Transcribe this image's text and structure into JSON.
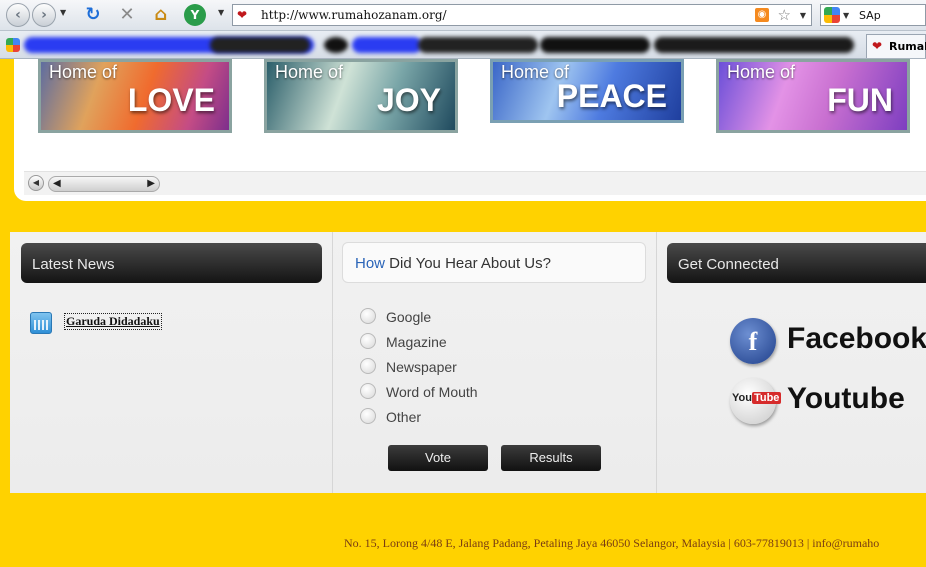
{
  "browser": {
    "url": "http://www.rumahozanam.org/",
    "search_text": "SAp",
    "tab_label": "Rumah"
  },
  "banners": [
    {
      "home": "Home of",
      "word": "LOVE"
    },
    {
      "home": "Home of",
      "word": "JOY"
    },
    {
      "home": "Home of",
      "word": "PEACE"
    },
    {
      "home": "Home of",
      "word": "FUN"
    }
  ],
  "latest_news": {
    "title": "Latest News",
    "items": [
      "Garuda Didadaku"
    ]
  },
  "poll": {
    "title_accent": "How",
    "title_rest": " Did You Hear About Us?",
    "options": [
      "Google",
      "Magazine",
      "Newspaper",
      "Word of Mouth",
      "Other"
    ],
    "vote_label": "Vote",
    "results_label": "Results"
  },
  "connected": {
    "title": "Get Connected",
    "facebook": "Facebook",
    "youtube": "Youtube",
    "youtube_mark_left": "You",
    "youtube_mark_right": "Tube",
    "facebook_glyph": "f"
  },
  "footer": {
    "text": "No. 15, Lorong 4/48 E, Jalang Padang, Petaling Jaya 46050 Selangor, Malaysia | 603-77819013 | info@rumaho"
  },
  "colors": {
    "page_yellow": "#ffd200",
    "panel_dark": "#141414",
    "accent_blue": "#2a64b8"
  }
}
